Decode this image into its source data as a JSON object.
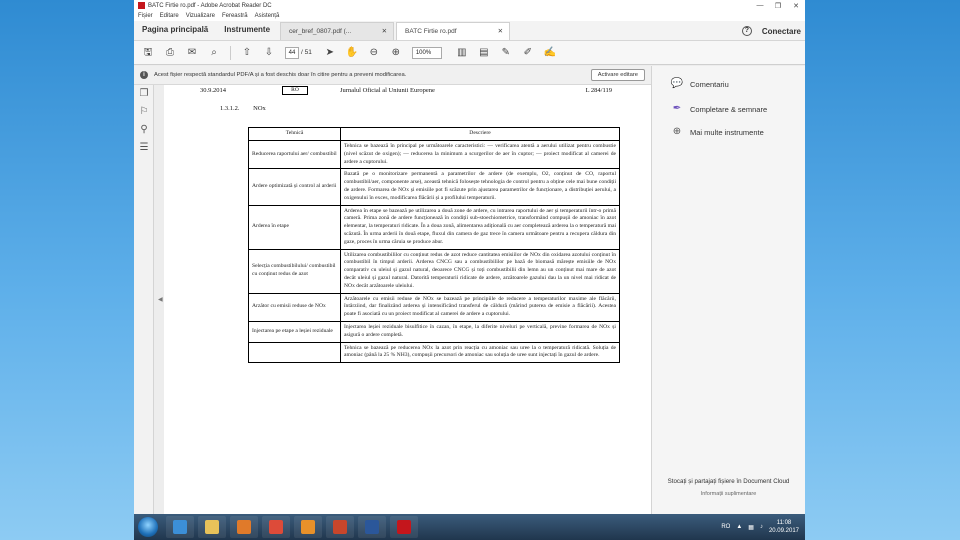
{
  "window": {
    "title": "BATC Firtie ro.pdf - Adobe Acrobat Reader DC",
    "controls": [
      "—",
      "❐",
      "✕"
    ]
  },
  "menu": [
    "Fișier",
    "Editare",
    "Vizualizare",
    "Fereastră",
    "Asistență"
  ],
  "nav": {
    "home": "Pagina principală",
    "tools": "Instrumente",
    "connect": "Conectare"
  },
  "tabs": [
    {
      "label": "cer_bref_0807.pdf (...",
      "active": false
    },
    {
      "label": "BATC Firtie ro.pdf",
      "active": true
    }
  ],
  "toolbar": {
    "page": "44",
    "page_count": "/ 51",
    "zoom": "100%"
  },
  "infobar": {
    "text": "Acest fișier respectă standardul PDF/A și a fost deschis doar în citire pentru a preveni modificarea.",
    "button": "Activare editare"
  },
  "document": {
    "date": "30.9.2014",
    "lang": "RO",
    "journal": "Jurnalul Oficial al Uniunii Europene",
    "page_ref": "L 284/119",
    "section_number": "1.3.1.2.",
    "section_title": "NOx",
    "table": {
      "headers": [
        "Tehnică",
        "Descriere"
      ],
      "rows": [
        {
          "tech": "Reducerea raportului aer/ combustibil",
          "desc": "Tehnica se bazează în principal pe următoarele caracteristici: — verificarea atentă a aerului utilizat pentru combustie (nivel scăzut de oxigen); — reducerea la minimum a scurgerilor de aer în cuptor; — proiect modificat al camerei de ardere a cuptorului."
        },
        {
          "tech": "Ardere optimizată și control al arderii",
          "desc": "Bazată pe o monitorizare permanentă a parametrilor de ardere (de exemplu, O2, conținut de CO, raportul combustibil/aer, componente arse), această tehnică folosește tehnologia de control pentru a obține cele mai bune condiții de ardere. Formarea de NOx și emisiile pot fi scăzute prin ajustarea parametrilor de funcționare, a distribuției aerului, a oxigenului în exces, modificarea flăcării și a profilului temperaturii."
        },
        {
          "tech": "Arderea în etape",
          "desc": "Arderea în etape se bazează pe utilizarea a două zone de ardere, cu intrarea raportului de aer și temperaturii într-o primă cameră. Prima zonă de ardere funcționează în condiții sub-stoechiometrice, transformând compușii de amoniac în azot elementar, la temperaturi ridicate. În a doua zonă, alimentarea adițională cu aer completează arderea la o temperatură mai scăzută. În urma arderii în două etape, fluxul din camera de gaz trece în camera următoare pentru a recupera căldura din gaze, proces în urma căruia se produce abur."
        },
        {
          "tech": "Selecția combustibilului/ combustibil cu conținut redus de azot",
          "desc": "Utilizarea combustibililor cu conținut redus de azot reduce cantitatea emisiilor de NOx din oxidarea azotului conținut în combustibil în timpul arderii. Arderea CNCG sau a combustibililor pe bază de biomasă mărește emisiile de NOx comparativ cu uleiul și gazul natural, deoarece CNCG și toți combustibilii din lemn au un conținut mai mare de azot decât uleiul și gazul natural. Datorită temperaturii ridicate de ardere, arzătoarele gazului dau la un nivel mai ridicat de NOx decât arzătoarele uleiului."
        },
        {
          "tech": "Arzător cu emisii reduse de NOx",
          "desc": "Arzătoarele cu emisii reduse de NOx se bazează pe principiile de reducere a temperaturilor maxime ale flăcării, întârziind, dar finalizând arderea și intensificând transferul de căldură (mărind puterea de emisie a flăcării). Acestea poate fi asociată cu un proiect modificat al camerei de ardere a cuptorului."
        },
        {
          "tech": "Injectarea pe etape a leșiei reziduale",
          "desc": "Injectarea leșiei reziduale bisulfitice în cazan, în etape, la diferite niveluri pe verticală, previne formarea de NOx și asigură o ardere completă."
        },
        {
          "tech": "",
          "desc": "Tehnica se bazează pe reducerea NOx la azot prin reacția cu amoniac sau uree la o temperatură ridicată. Soluția de amoniac (până la 25 % NH3), compușii precursori de amoniac sau soluția de uree sunt injectați în gazul de ardere."
        }
      ]
    }
  },
  "right_panel": {
    "items": [
      {
        "label": "Comentariu",
        "icon": "comment-icon",
        "color": "#f2b01e"
      },
      {
        "label": "Completare & semnare",
        "icon": "sign-icon",
        "color": "#6b4fbb"
      },
      {
        "label": "Mai multe instrumente",
        "icon": "tools-icon",
        "color": "#555555"
      }
    ],
    "promo_title": "Stocați și partajați fișiere în Document Cloud",
    "promo_link": "Informații suplimentare"
  },
  "taskbar": {
    "apps": [
      {
        "name": "ie",
        "color": "#3c8fd8"
      },
      {
        "name": "explorer",
        "color": "#e8c25a"
      },
      {
        "name": "media",
        "color": "#e07a2a"
      },
      {
        "name": "chrome",
        "color": "#dd4b39"
      },
      {
        "name": "outlook",
        "color": "#e8912a"
      },
      {
        "name": "powerpoint",
        "color": "#c8462b"
      },
      {
        "name": "word",
        "color": "#2b579a"
      },
      {
        "name": "acrobat",
        "color": "#c4161c"
      }
    ],
    "lang": "RO",
    "time": "11:08",
    "date": "20.09.2017"
  }
}
